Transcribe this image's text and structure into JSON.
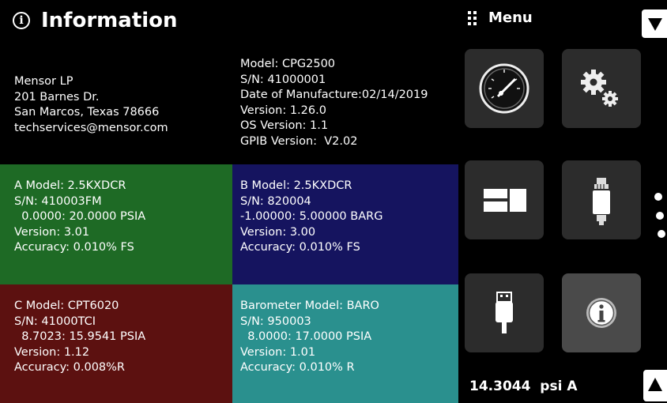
{
  "header": {
    "title": "Information",
    "icon": "info-icon"
  },
  "company": {
    "lines": [
      "Mensor LP",
      "201 Barnes Dr.",
      "San Marcos, Texas 78666",
      "techservices@mensor.com"
    ]
  },
  "device": {
    "lines": [
      "Model: CPG2500",
      "S/N: 41000001",
      "Date of Manufacture:02/14/2019",
      "Version: 1.26.0",
      "OS Version: 1.1",
      "GPIB Version:  V2.02"
    ]
  },
  "sensors": {
    "a": {
      "lines": [
        "A Model: 2.5KXDCR",
        "S/N: 410003FM",
        "  0.0000: 20.0000 PSIA",
        "Version: 3.01",
        "Accuracy: 0.010% FS"
      ],
      "color": "#1e6a25"
    },
    "b": {
      "lines": [
        "B Model: 2.5KXDCR",
        "S/N: 820004",
        "-1.00000: 5.00000 BARG",
        "Version: 3.00",
        "Accuracy: 0.010% FS"
      ],
      "color": "#15145f"
    },
    "c": {
      "lines": [
        "C Model: CPT6020",
        "S/N: 41000TCI",
        "  8.7023: 15.9541 PSIA",
        "Version: 1.12",
        "Accuracy: 0.008%R"
      ],
      "color": "#5c1110"
    },
    "d": {
      "lines": [
        "Barometer Model: BARO",
        "S/N: 950003",
        "  8.0000: 17.0000 PSIA",
        "Version: 1.01",
        "Accuracy: 0.010% R"
      ],
      "color": "#2a908e"
    }
  },
  "menu": {
    "label": "Menu",
    "tiles": [
      {
        "icon": "gauge-icon"
      },
      {
        "icon": "gears-icon"
      },
      {
        "icon": "display-layout-icon"
      },
      {
        "icon": "transducer-icon"
      },
      {
        "icon": "usb-icon"
      },
      {
        "icon": "info-icon",
        "active": true
      }
    ]
  },
  "reading": {
    "value": "14.3044",
    "unit": "psi A"
  }
}
